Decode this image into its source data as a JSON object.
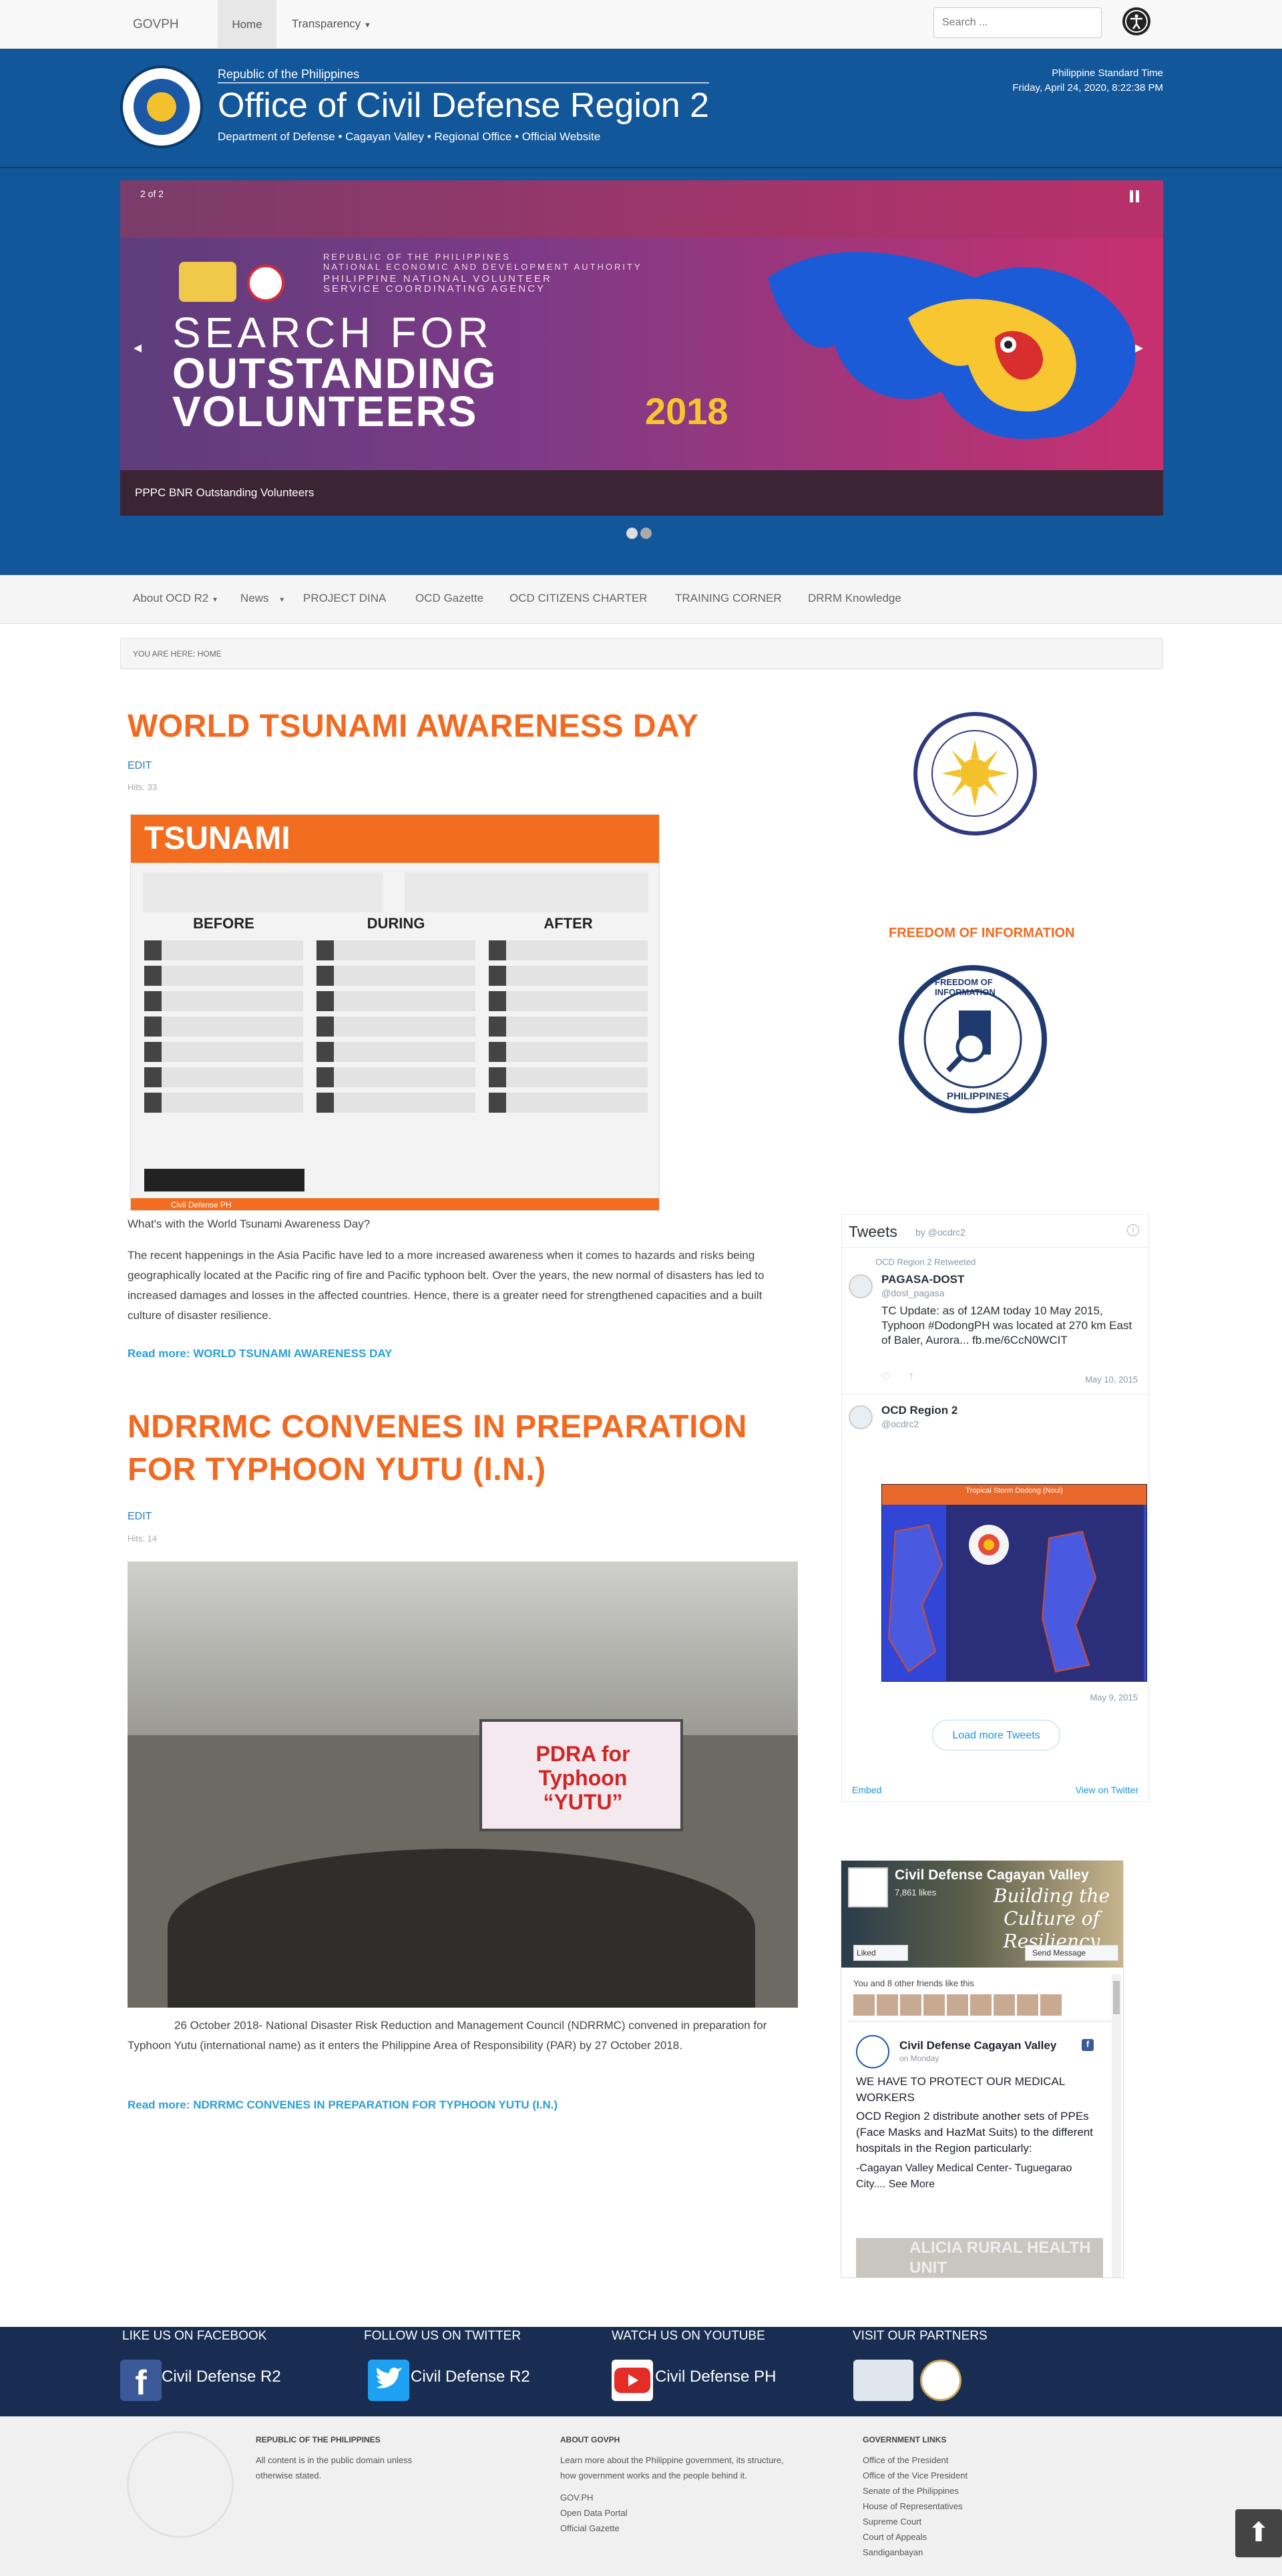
{
  "topbar": {
    "brand": "GOVPH",
    "home": "Home",
    "transparency": "Transparency",
    "search_placeholder": "Search ..."
  },
  "header": {
    "republic": "Republic of the Philippines",
    "title": "Office of Civil Defense Region 2",
    "subtitle": "Department of Defense • Cagayan Valley • Regional Office • Official Website",
    "pst_label": "Philippine Standard Time",
    "pst_value": "Friday, April 24, 2020, 8:22:38 PM"
  },
  "slider": {
    "counter": "2 of 2",
    "line1": "REPUBLIC OF THE PHILIPPINES",
    "line2": "NATIONAL ECONOMIC AND DEVELOPMENT AUTHORITY",
    "line3": "PHILIPPINE NATIONAL VOLUNTEER",
    "line4": "SERVICE COORDINATING AGENCY",
    "headline1": "SEARCH FOR",
    "headline2": "OUTSTANDING",
    "headline3": "VOLUNTEERS",
    "year": "2018",
    "caption": "PPPC BNR Outstanding Volunteers",
    "prev": "◂",
    "next": "▸"
  },
  "nav": {
    "items": [
      "About OCD R2",
      "News",
      "PROJECT DINA",
      "OCD Gazette",
      "OCD CITIZENS CHARTER",
      "TRAINING CORNER",
      "DRRM Knowledge"
    ]
  },
  "breadcrumb": "YOU ARE HERE:   HOME",
  "articles": [
    {
      "title": "WORLD TSUNAMI AWARENESS DAY",
      "edit": "EDIT",
      "hits": "Hits: 33",
      "image_banner": "TSUNAMI",
      "image_cols": [
        "BEFORE",
        "DURING",
        "AFTER"
      ],
      "image_footer": "Civil Defense PH",
      "lead": "What's with the World Tsunami Awareness Day?",
      "body": "The recent happenings in the Asia Pacific have led to a more increased awareness when it comes to hazards and risks being geographically located at the Pacific ring of fire and Pacific typhoon belt. Over the years, the new normal of disasters has led to increased damages and losses in the affected countries. Hence, there is a greater need for strengthened capacities and a built culture of disaster resilience.",
      "readmore": "Read more: WORLD TSUNAMI AWARENESS DAY"
    },
    {
      "title_l1": "NDRRMC CONVENES IN PREPARATION",
      "title_l2": "FOR TYPHOON YUTU (I.N.)",
      "edit": "EDIT",
      "hits": "Hits: 14",
      "screen": "PDRA for Typhoon “YUTU”",
      "body": "26 October 2018- National Disaster Risk Reduction and Management Council (NDRRMC) convened in preparation for Typhoon Yutu (international name) as it enters the Philippine Area of Responsibility (PAR) by 27 October 2018.",
      "readmore": "Read more: NDRRMC CONVENES IN PREPARATION FOR TYPHOON YUTU (I.N.)"
    }
  ],
  "sidebar": {
    "transparency_ring": "PHILIPPINE TRANSPARENCY SEAL",
    "foi_title": "FREEDOM OF INFORMATION",
    "foi_ring_top": "FREEDOM OF INFORMATION",
    "foi_ring_bottom": "PHILIPPINES"
  },
  "tweets": {
    "title": "Tweets",
    "by": "by @ocdrc2",
    "items": [
      {
        "retweet": "OCD Region 2 Retweeted",
        "name": "PAGASA-DOST",
        "handle": "@dost_pagasa",
        "text": "TC Update: as of 12AM today 10 May 2015, Typhoon #DodongPH was located at 270 km East of Baler, Aurora... fb.me/6CcN0WCIT",
        "date": "May 10, 2015"
      },
      {
        "name": "OCD Region 2",
        "handle": "@ocdrc2",
        "map_header": "Tropical Storm Dodong (Noul)",
        "date": "May 9, 2015"
      }
    ],
    "load_more": "Load more Tweets",
    "embed": "Embed",
    "view": "View on Twitter"
  },
  "facebook": {
    "page": "Civil Defense Cagayan Valley",
    "likes": "7,861 likes",
    "slogan": "Building the Culture of Resiliency",
    "liked": "Liked",
    "send": "Send Message",
    "friends": "You and 8 other friends like this",
    "post_when": "on Monday",
    "post_title": "WE HAVE TO PROTECT OUR MEDICAL WORKERS",
    "post_body": "OCD Region 2 distribute another sets of PPEs (Face Masks and HazMat Suits) to the different hospitals in the Region particularly:",
    "post_more": "-Cagayan Valley Medical Center- Tuguegarao City.... See More",
    "post_img": "ALICIA RURAL HEALTH UNIT"
  },
  "footband": {
    "facebook_head": "LIKE US ON FACEBOOK",
    "facebook_label": "Civil Defense R2",
    "twitter_head": "FOLLOW US ON TWITTER",
    "twitter_label": "Civil Defense R2",
    "youtube_head": "WATCH US ON YOUTUBE",
    "youtube_label": "Civil Defense PH",
    "partners_head": "VISIT OUR PARTNERS"
  },
  "footer": {
    "col1_head": "REPUBLIC OF THE PHILIPPINES",
    "col1_text": "All content is in the public domain unless otherwise stated.",
    "col2_head": "ABOUT GOVPH",
    "col2_text": "Learn more about the Philippine government, its structure, how government works and the people behind it.",
    "col2_links": [
      "GOV.PH",
      "Open Data Portal",
      "Official Gazette"
    ],
    "col3_head": "GOVERNMENT LINKS",
    "col3_links": [
      "Office of the President",
      "Office of the Vice President",
      "Senate of the Philippines",
      "House of Representatives",
      "Supreme Court",
      "Court of Appeals",
      "Sandiganbayan"
    ]
  },
  "colors": {
    "header_blue": "#13579b",
    "accent_orange": "#f26a21",
    "link_blue": "#2a9fd6",
    "footband": "#182d51"
  }
}
